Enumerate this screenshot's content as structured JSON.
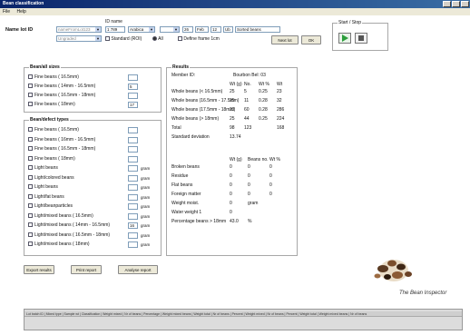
{
  "window": {
    "title": "Bean classification"
  },
  "menu": [
    "File",
    "Help"
  ],
  "top": {
    "batch_label": "Name lot ID",
    "batch_sub_label": "ID name",
    "lot_value": "nameFromLot123",
    "id_value": "1 789",
    "variety_value": "Arabica",
    "date_day": "26",
    "date_month": "Feb",
    "date_year": "12",
    "date_unit": "Ub",
    "owner_value": "Sorted beans",
    "second_combo_value": "Ungraded",
    "option_standard": "Standard (ROI)",
    "option_all": "All",
    "option_select": "Define frame 1cm",
    "next_lot": "Next lot",
    "ok": "OK"
  },
  "start_stop": {
    "title": "Start / Stop"
  },
  "sieve_group": {
    "title": "Bean/all sizes",
    "rows": [
      {
        "label": "Fine beans ( 16.5mm)",
        "value": ""
      },
      {
        "label": "Fine beans ( 14mm - 16.5mm)",
        "value": "5"
      },
      {
        "label": "Fine beans ( 16.5mm - 18mm)",
        "value": ""
      },
      {
        "label": "Fine beans ( 18mm)",
        "value": "17"
      }
    ]
  },
  "defect_group": {
    "title": "Bean/defect types",
    "rows": [
      {
        "label": "Fine beans ( 16.5mm)",
        "value": "",
        "unit": ""
      },
      {
        "label": "Fine beans ( 16mm - 16.5mm)",
        "value": "",
        "unit": ""
      },
      {
        "label": "Fine beans ( 16.5mm - 18mm)",
        "value": "",
        "unit": ""
      },
      {
        "label": "Fine beans ( 18mm)",
        "value": "",
        "unit": ""
      },
      {
        "label": "Light beans",
        "value": "",
        "unit": "gram"
      },
      {
        "label": "Light/colored beans",
        "value": "",
        "unit": "gram"
      },
      {
        "label": "Light beans",
        "value": "",
        "unit": "gram"
      },
      {
        "label": "Light/fat beans",
        "value": "",
        "unit": "gram"
      },
      {
        "label": "Light/beanparticles",
        "value": "",
        "unit": "gram"
      },
      {
        "label": "Light/mixed beans ( 16.5mm)",
        "value": "",
        "unit": "gram"
      },
      {
        "label": "Light/mixed beans ( 14mm - 16.5mm)",
        "value": "16",
        "unit": "gram"
      },
      {
        "label": "Light/mixed beans ( 16.5mm - 18mm)",
        "value": "",
        "unit": "gram"
      },
      {
        "label": "Light/mixed beans ( 18mm)",
        "value": "",
        "unit": "gram"
      }
    ]
  },
  "buttons": {
    "export": "Export results",
    "print": "Print report",
    "analyse": "Analyse report"
  },
  "results": {
    "title": "Results",
    "member_label": "Member ID:",
    "member_value": "Bourbon Bel: 03",
    "head1": [
      "Wt (g)",
      "No.",
      "Wt %",
      "Wt"
    ],
    "rows1": [
      {
        "label": "Whole beans (< 16.5mm)",
        "cells": [
          "25",
          "5",
          "0.25",
          "23"
        ]
      },
      {
        "label": "Whole beans (16.5mm - 17.5mm)",
        "cells": [
          "25",
          "11",
          "0.28",
          "32"
        ]
      },
      {
        "label": "Whole beans (17.5mm - 18mm)",
        "cells": [
          "22",
          "60",
          "0.28",
          "286"
        ]
      },
      {
        "label": "Whole beans (> 18mm)",
        "cells": [
          "25",
          "44",
          "0.25",
          "224"
        ]
      },
      {
        "label": "Total",
        "cells": [
          "98",
          "123",
          "",
          "168"
        ]
      },
      {
        "label": "Standard deviation",
        "cells": [
          "13.74",
          "",
          "",
          ""
        ]
      }
    ],
    "head2": [
      "Wt (g)",
      "Beans no.",
      "Wt %"
    ],
    "rows2": [
      {
        "label": "Broken beans",
        "cells": [
          "0",
          "0",
          "0"
        ]
      },
      {
        "label": "Residue",
        "cells": [
          "0",
          "0",
          "0"
        ]
      },
      {
        "label": "Flat beans",
        "cells": [
          "0",
          "0",
          "0"
        ]
      },
      {
        "label": "Foreign matter",
        "cells": [
          "0",
          "0",
          "0"
        ]
      },
      {
        "label": "Weight moist.",
        "cells": [
          "0",
          "gram",
          ""
        ]
      },
      {
        "label": "Water weight 1",
        "cells": [
          "0",
          "",
          ""
        ]
      },
      {
        "label": "Percentage beans > 18mm",
        "cells": [
          "43.0",
          "%",
          ""
        ]
      }
    ]
  },
  "logo": {
    "text": "The Bean Inspector"
  },
  "bottom_table": {
    "header": "Lot batch ID | Mixed type | Sample wt | Classification | Weight mixed | Nr of beans | Percentage | Weight mixed beans | Weight total | Nr of beans | Percent | Weight mixed | Nr of beans | Percent | Weight total | Weight mixed beans | Nr of beans"
  }
}
